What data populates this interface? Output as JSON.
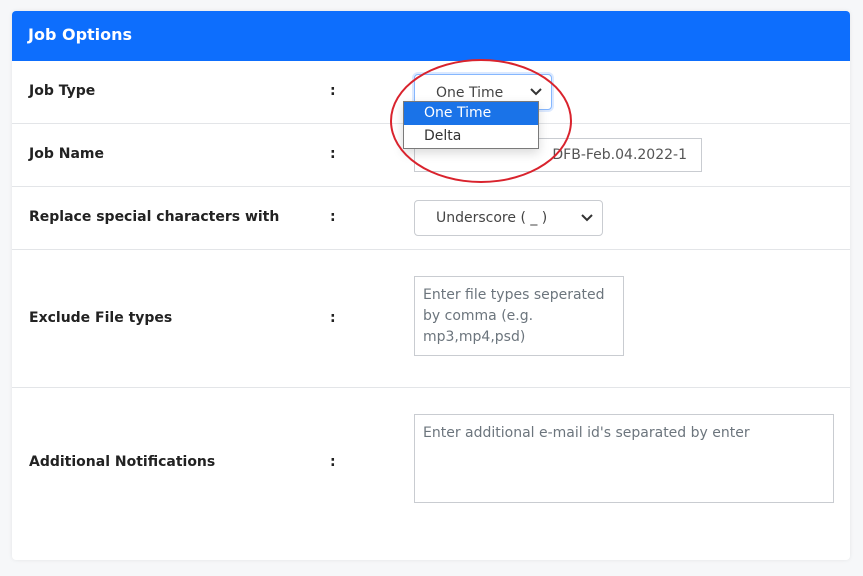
{
  "card": {
    "title": "Job Options"
  },
  "job_type": {
    "label": "Job Type",
    "colon": ":",
    "selected": "One Time",
    "options": [
      "One Time",
      "Delta"
    ]
  },
  "job_name": {
    "label": "Job Name",
    "colon": ":",
    "value_visible": "DFB-Feb.04.2022-1"
  },
  "replace_chars": {
    "label": "Replace special characters with",
    "colon": ":",
    "selected": "Underscore ( _ )"
  },
  "exclude_file_types": {
    "label": "Exclude File types",
    "colon": ":",
    "placeholder": "Enter file types seperated by comma (e.g. mp3,mp4,psd)"
  },
  "notifications": {
    "label": "Additional Notifications",
    "colon": ":",
    "placeholder": "Enter additional e-mail id's separated by enter"
  },
  "colors": {
    "header": "#0d6efd",
    "highlight": "#1a73e8",
    "annotation": "#d9232d"
  }
}
